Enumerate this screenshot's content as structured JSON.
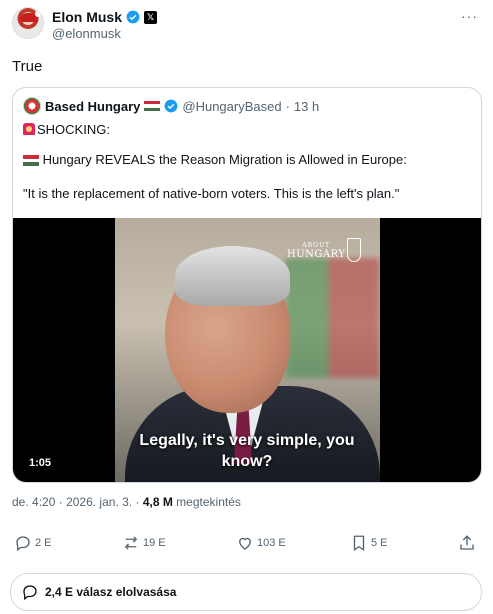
{
  "author": {
    "name": "Elon Musk",
    "handle": "@elonmusk",
    "affiliate_badge": "𝕏"
  },
  "post": {
    "text": "True"
  },
  "quoted": {
    "name": "Based Hungary",
    "handle": "@HungaryBased",
    "separator": "·",
    "time": "13 h",
    "line1": "SHOCKING:",
    "line2": "Hungary REVEALS the Reason Migration is Allowed in Europe:",
    "line3": "\"It is the replacement of native-born voters. This is the left's plan.\"",
    "video": {
      "brand_small": "ABOUT",
      "brand_big": "HUNGARY",
      "caption_line1": "Legally, it's very simple, you",
      "caption_line2": "know?",
      "duration": "1:05"
    }
  },
  "meta": {
    "time": "de. 4:20",
    "dot": "·",
    "date": "2026. jan. 3.",
    "views": "4,8 M",
    "views_label": "megtekintés"
  },
  "actions": {
    "replies": "2 E",
    "reposts": "19 E",
    "likes": "103 E",
    "bookmarks": "5 E"
  },
  "read_replies": "2,4 E válasz elolvasása",
  "colors": {
    "verified": "#1d9bf0",
    "text_secondary": "#536471",
    "border": "#cfd9de",
    "flag_red": "#cd2a3e",
    "flag_green": "#436f4d"
  }
}
